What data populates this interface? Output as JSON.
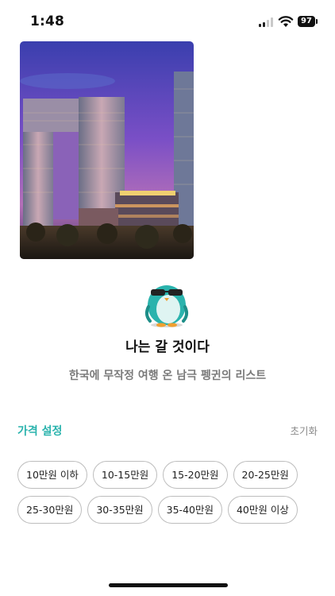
{
  "status_bar": {
    "time": "1:48",
    "battery": "97"
  },
  "hero": {
    "image_label": "hotel-night-photo"
  },
  "profile": {
    "title": "나는 갈 것이다",
    "subtitle": "한국에 무작정 여행 온 남극 펭귄의 리스트"
  },
  "price_filter": {
    "label": "가격 설정",
    "reset_label": "초기화",
    "accent_color": "#2ab3ad",
    "options_row1": [
      "10만원 이하",
      "10-15만원",
      "15-20만원",
      "20-25만원"
    ],
    "options_row2": [
      "25-30만원",
      "30-35만원",
      "35-40만원",
      "40만원 이상"
    ]
  }
}
